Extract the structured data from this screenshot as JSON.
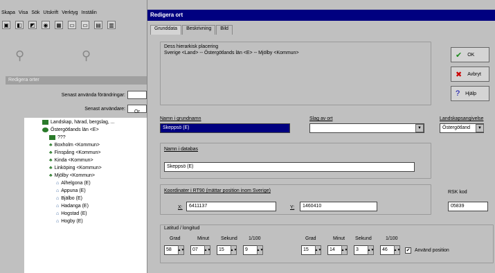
{
  "menu": [
    "Skapa",
    "Visa",
    "Sök",
    "Utskrift",
    "Verktyg",
    "Instälin"
  ],
  "toolbar_icons": [
    "save-icon",
    "open-icon",
    "edit-icon",
    "globe-icon",
    "grid-icon",
    "window-icon",
    "window-icon",
    "window-icon",
    "window-icon"
  ],
  "side": {
    "panel_title": "Redigera orter",
    "recent_label": "Senast använda förändringar:",
    "recent_user_label": "Senast användare:",
    "tree_header": "Or",
    "tree": [
      "Landskap, härad, bergslag, ...",
      "Östergötlands län <E>",
      "???",
      "Boxholm <Kommun>",
      "Finspång <Kommun>",
      "Kinda <Kommun>",
      "Linköping <Kommun>",
      "Mjölby <Kommun>",
      "Alhelgona (E)",
      "Appuna (E)",
      "Bjälbo (E)",
      "Hadanga (E)",
      "Hogstad (E)",
      "Hogby (E)"
    ]
  },
  "dialog": {
    "title": "Redigera ort",
    "tabs": [
      "Grunddata",
      "Beskrivning",
      "Bild"
    ],
    "hierarchy_label": "Dess hierarkisk placering",
    "hierarchy_value": "Sverige <Land> -- Östergötlands län <E> -- Mjölby <Kommun>",
    "name_label": "Namn i grundnamn",
    "name_value": "Skeppsö (E)",
    "type_label": "Slag av ort",
    "type_value": "",
    "region_label": "Landskapsangivelse",
    "region_value": "Östergötland",
    "database_label": "Namn i databas",
    "database_value": "Skeppsö (E)",
    "coord_label": "Koordinater i RT90 (mättar position inom Sverige)",
    "x_label": "X:",
    "x_value": "6411137",
    "y_label": "Y:",
    "y_value": "1460410",
    "rsk_label": "RSK kod",
    "rsk_value": "05839",
    "latlong_label": "Latitud / longitud",
    "col_grad": "Grad",
    "col_minut": "Minut",
    "col_sekund": "Sekund",
    "col_hundredth": "1/100",
    "lat": [
      "58",
      "07",
      "15",
      "9"
    ],
    "lon": [
      "15",
      "14",
      "3",
      "46"
    ],
    "use_pos_label": "Använd position",
    "ok_label": "OK",
    "cancel_label": "Avbryt",
    "help_label": "Hjälp"
  }
}
